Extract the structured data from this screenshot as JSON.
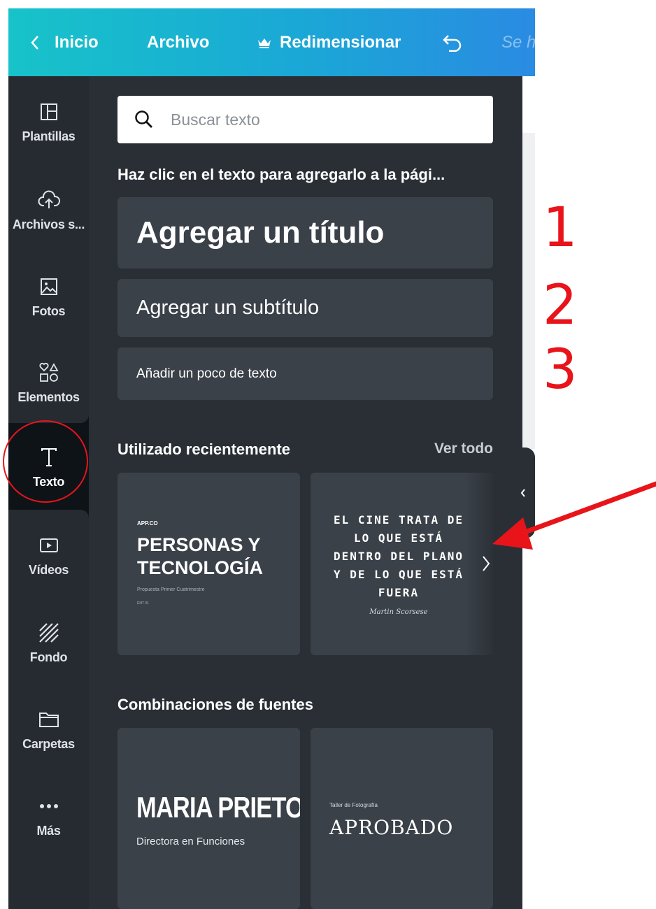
{
  "topbar": {
    "back_label": "Inicio",
    "file_label": "Archivo",
    "resize_label": "Redimensionar",
    "saved_label": "Se h"
  },
  "sidebar": {
    "items": [
      {
        "label": "Plantillas",
        "icon": "layout-icon"
      },
      {
        "label": "Archivos s...",
        "icon": "upload-cloud-icon"
      },
      {
        "label": "Fotos",
        "icon": "photo-icon"
      },
      {
        "label": "Elementos",
        "icon": "shapes-icon"
      },
      {
        "label": "Texto",
        "icon": "text-icon"
      },
      {
        "label": "Vídeos",
        "icon": "video-icon"
      },
      {
        "label": "Fondo",
        "icon": "background-icon"
      },
      {
        "label": "Carpetas",
        "icon": "folder-icon"
      },
      {
        "label": "Más",
        "icon": "more-icon"
      }
    ]
  },
  "search": {
    "placeholder": "Buscar texto"
  },
  "panel": {
    "hint": "Haz clic en el texto para agregarlo a la pági...",
    "add_title": "Agregar un título",
    "add_subtitle": "Agregar un subtítulo",
    "add_body": "Añadir un poco de texto",
    "recent_title": "Utilizado recientemente",
    "see_all": "Ver todo",
    "combos_title": "Combinaciones de fuentes"
  },
  "recent": {
    "card1": {
      "small_top": "APP.CO",
      "line1": "PERSONAS Y",
      "line2": "TECNOLOGÍA",
      "subtitle": "Propuesta Primer Cuatrimestre",
      "tiny": "ENT 01"
    },
    "card2": {
      "line1": "EL CINE TRATA DE",
      "line2": "LO QUE ESTÁ",
      "line3": "DENTRO DEL PLANO",
      "line4": "Y DE LO QUE ESTÁ",
      "line5": "FUERA",
      "author": "Martin Scorsese"
    }
  },
  "combos": {
    "card1": {
      "title": "MARIA PRIETO",
      "subtitle": "Directora en Funciones"
    },
    "card2": {
      "small": "Taller de Fotografía",
      "title": "APROBADO"
    }
  },
  "annotations": {
    "n1": "1",
    "n2": "2",
    "n3": "3",
    "color": "#e8141a"
  },
  "colors": {
    "topbar_start": "#17c3c9",
    "topbar_end": "#2a8be2",
    "panel_bg": "#2a2f36",
    "card_bg": "#3b4149",
    "nav_bg": "#0e1318"
  }
}
